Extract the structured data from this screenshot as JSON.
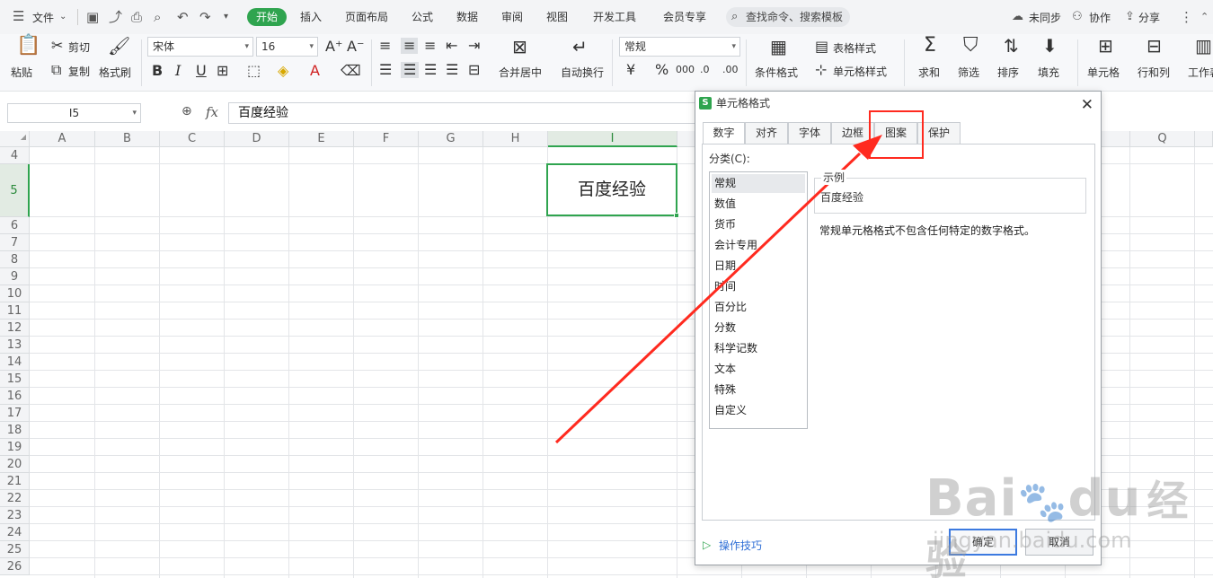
{
  "menubar": {
    "file_label": "文件",
    "tabs": [
      "开始",
      "插入",
      "页面布局",
      "公式",
      "数据",
      "审阅",
      "视图",
      "开发工具",
      "会员专享"
    ],
    "search_label": "查找命令、搜索模板",
    "right": [
      "未同步",
      "协作",
      "分享"
    ]
  },
  "ribbon": {
    "paste": "粘贴",
    "cut": "剪切",
    "copy": "复制",
    "format_painter": "格式刷",
    "font_name": "宋体",
    "font_size": "16",
    "merge_center": "合并居中",
    "auto_wrap": "自动换行",
    "number_format": "常规",
    "table_style": "表格样式",
    "cond_format": "条件格式",
    "cell_style": "单元格样式",
    "sum": "求和",
    "filter": "筛选",
    "sort": "排序",
    "fill": "填充",
    "cell": "单元格",
    "row_col": "行和列",
    "worksheet": "工作表"
  },
  "formula": {
    "name_box": "I5",
    "fx": "fx",
    "value": "百度经验"
  },
  "sheet": {
    "columns": [
      "A",
      "B",
      "C",
      "D",
      "E",
      "F",
      "G",
      "H",
      "I",
      "Q"
    ],
    "rows": [
      "4",
      "5",
      "6",
      "7",
      "8",
      "9",
      "10",
      "11",
      "12",
      "13",
      "14",
      "15",
      "16",
      "17",
      "18",
      "19",
      "20",
      "21",
      "22",
      "23",
      "24",
      "25",
      "26"
    ],
    "active_cell_text": "百度经验"
  },
  "dialog": {
    "title": "单元格格式",
    "tabs": [
      "数字",
      "对齐",
      "字体",
      "边框",
      "图案",
      "保护"
    ],
    "category_label": "分类(C):",
    "categories": [
      "常规",
      "数值",
      "货币",
      "会计专用",
      "日期",
      "时间",
      "百分比",
      "分数",
      "科学记数",
      "文本",
      "特殊",
      "自定义"
    ],
    "sample_label": "示例",
    "sample_value": "百度经验",
    "description": "常规单元格格式不包含任何特定的数字格式。",
    "tips_link": "操作技巧",
    "ok": "确定",
    "cancel": "取消"
  },
  "watermark": {
    "brand": "Bai",
    "brand2": "du",
    "cn": "经验",
    "url": "jingyan.baidu.com"
  },
  "colors": {
    "accent": "#2fa44f",
    "annotation": "#ff2a1f"
  }
}
